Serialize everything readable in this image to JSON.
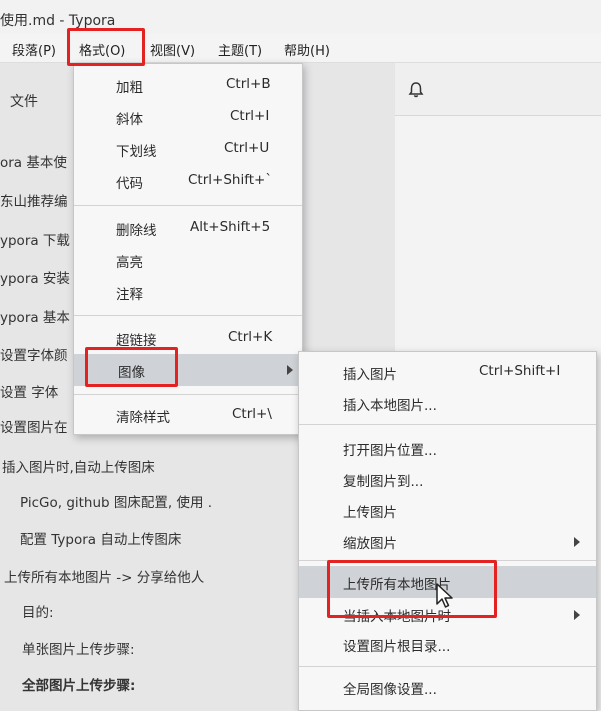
{
  "window_title": "使用.md - Typora",
  "menubar": {
    "items": [
      "段落(P)",
      "格式(O)",
      "视图(V)",
      "主题(T)",
      "帮助(H)"
    ]
  },
  "sidebar": {
    "files_label": "文件",
    "outline": [
      "ora 基本使",
      "东山推荐编",
      "ypora 下载",
      "ypora 安装",
      "ypora 基本",
      "设置字体颜",
      "设置 字体",
      "设置图片在",
      "插入图片时,自动上传图床",
      "PicGo, github 图床配置, 使用 .",
      "配置 Typora 自动上传图床",
      "上传所有本地图片 -> 分享给他人",
      "目的:",
      "单张图片上传步骤:",
      "全部图片上传步骤:"
    ]
  },
  "format_menu": {
    "items": [
      {
        "label": "加粗",
        "shortcut": "Ctrl+B"
      },
      {
        "label": "斜体",
        "shortcut": "Ctrl+I"
      },
      {
        "label": "下划线",
        "shortcut": "Ctrl+U"
      },
      {
        "label": "代码",
        "shortcut": "Ctrl+Shift+`"
      },
      {
        "label": "删除线",
        "shortcut": "Alt+Shift+5"
      },
      {
        "label": "高亮",
        "shortcut": ""
      },
      {
        "label": "注释",
        "shortcut": ""
      },
      {
        "label": "超链接",
        "shortcut": "Ctrl+K"
      },
      {
        "label": "图像",
        "shortcut": ""
      },
      {
        "label": "清除样式",
        "shortcut": "Ctrl+\\"
      }
    ]
  },
  "image_submenu": {
    "items": [
      {
        "label": "插入图片",
        "shortcut": "Ctrl+Shift+I"
      },
      {
        "label": "插入本地图片...",
        "shortcut": ""
      },
      {
        "label": "打开图片位置...",
        "shortcut": ""
      },
      {
        "label": "复制图片到...",
        "shortcut": ""
      },
      {
        "label": "上传图片",
        "shortcut": ""
      },
      {
        "label": "缩放图片",
        "shortcut": ""
      },
      {
        "label": "上传所有本地图片",
        "shortcut": ""
      },
      {
        "label": "当插入本地图片时",
        "shortcut": ""
      },
      {
        "label": "设置图片根目录...",
        "shortcut": ""
      },
      {
        "label": "全局图像设置...",
        "shortcut": ""
      }
    ]
  },
  "icons": {
    "bell": "bell-icon",
    "submenu_arrow": "chevron-right-icon",
    "cursor": "mouse-pointer-icon"
  },
  "colors": {
    "highlight_box": "#e52222",
    "menu_highlight": "#cfd2d6"
  }
}
